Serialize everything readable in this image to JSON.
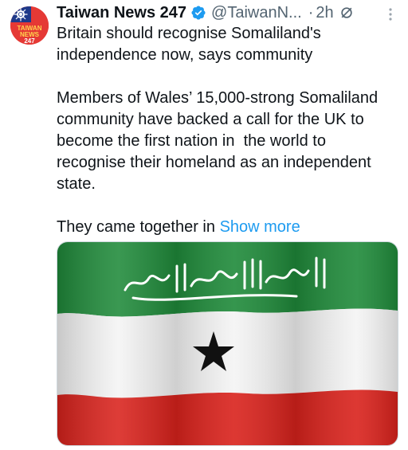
{
  "tweet": {
    "author": {
      "name": "Taiwan News 247",
      "handle": "@TaiwanN...",
      "avatar_text": "TAIWAN NEWS 247",
      "verified_color": "#1d9bf0"
    },
    "separator": "·",
    "time": "2h",
    "text": {
      "headline": "Britain should recognise Somaliland's independence now, says community",
      "body": "Members of Wales’ 15,000-strong Somaliland  community have backed a call for the UK to become the first nation in  the world to recognise their homeland as an independent state.",
      "truncated": "They came together in ",
      "show_more": "Show more"
    },
    "media": {
      "description_icon": "somaliland-flag-image",
      "colors": {
        "green": "#1f8a3a",
        "white": "#ffffff",
        "red": "#d9221c",
        "star": "#111111"
      }
    }
  },
  "icons": {
    "verified": "verified-badge-icon",
    "grok": "grok-icon",
    "more": "more-options-icon"
  }
}
